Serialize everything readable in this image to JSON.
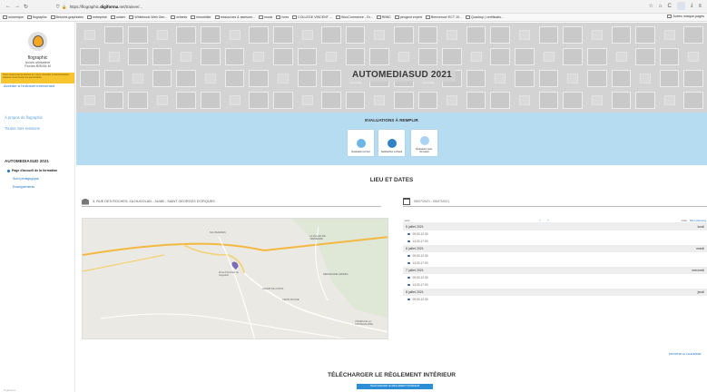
{
  "browser": {
    "url_prefix": "https://",
    "url_domain": "flographic.",
    "url_domain_bold": "digiforma",
    "url_rest": ".net/trainee/...",
    "bookmarks": [
      "numerique",
      "flographic",
      "Besoins graphistes",
      "entreprise",
      "unisev",
      "Whitebook Web Gen...",
      "enfants",
      "immobilier",
      "ressources & awesom...",
      "music",
      "Ivres",
      "COLLEGE VINCENT ...",
      "WooCommerce - Gr...",
      "RBNC",
      "peugeot expert",
      "Bienvenue! ECT 10...",
      "Quadrup | certificatio..."
    ],
    "bookmarks_right": "Autres marque-pages"
  },
  "sidebar": {
    "name": "flographic",
    "sub_lines": [
      "Accès utilisateur",
      "Florian BRIAN M"
    ],
    "yellow_notice": "Vous n'avez pas de licence en cours. Accédez à l'administration. Assurez-vous d'avoir les permissions.",
    "access_link": "Accéder à l'extranet intervenant",
    "links": [
      "À propos de flographic",
      "Toutes mes sessions"
    ],
    "section": "AUTOMEDIASUD 2021",
    "items": [
      "Page d'accueil de la formation",
      "Suivi pédagogique",
      "Enseignements"
    ],
    "bottom": "Digiforma"
  },
  "banner": {
    "title": "AUTOMEDIASUD 2021"
  },
  "evaluations": {
    "title": "EVALUATIONS À REMPLIR",
    "cards": [
      {
        "label": "Évaluation à froid",
        "color": "#6db6e8"
      },
      {
        "label": "Satisfaction à chaud",
        "color": "#2f82c6"
      },
      {
        "label": "Évaluation post-formation",
        "color": "#a9d3f0"
      }
    ]
  },
  "lieu": {
    "title": "LIEU ET DATES",
    "address": "3, RUE DES ROCHES, ZA HUGOLAN - 34480 - SAINT GEORGES D'ORQUES",
    "dates": "05/07/2021 - 09/07/2021",
    "map_labels": [
      "NAUTEARDES",
      "LA VALLES DE VERMENDE",
      "Zone d'Activités de Huguelan",
      "CHAMP DE COSTE",
      "CROIX ROUGE",
      "SERGEAUNE LEDRES",
      "VIGNES DE LA CANTAGALIANE"
    ],
    "planning": {
      "header_left": "mois",
      "header_right": [
        "Liste",
        "Mon planning"
      ],
      "days": [
        {
          "date": "5 juillet 2021",
          "weekday": "lundi",
          "slots": [
            "09:30-12:30",
            "13:30-17:00"
          ]
        },
        {
          "date": "6 juillet 2021",
          "weekday": "mardi",
          "slots": [
            "09:30-12:30",
            "13:30-17:00"
          ]
        },
        {
          "date": "7 juillet 2021",
          "weekday": "mercredi",
          "slots": [
            "09:30-12:30",
            "13:30-17:00"
          ]
        },
        {
          "date": "8 juillet 2021",
          "weekday": "jeudi",
          "slots": [
            "09:30-12:30"
          ]
        }
      ],
      "export": "EXPORTER LE CALENDRIER"
    }
  },
  "reglement": {
    "title": "TÉLÉCHARGER LE RÈGLEMENT INTÉRIEUR",
    "button": "TÉLÉCHARGER LE RÈGLEMENT INTÉRIEUR"
  }
}
